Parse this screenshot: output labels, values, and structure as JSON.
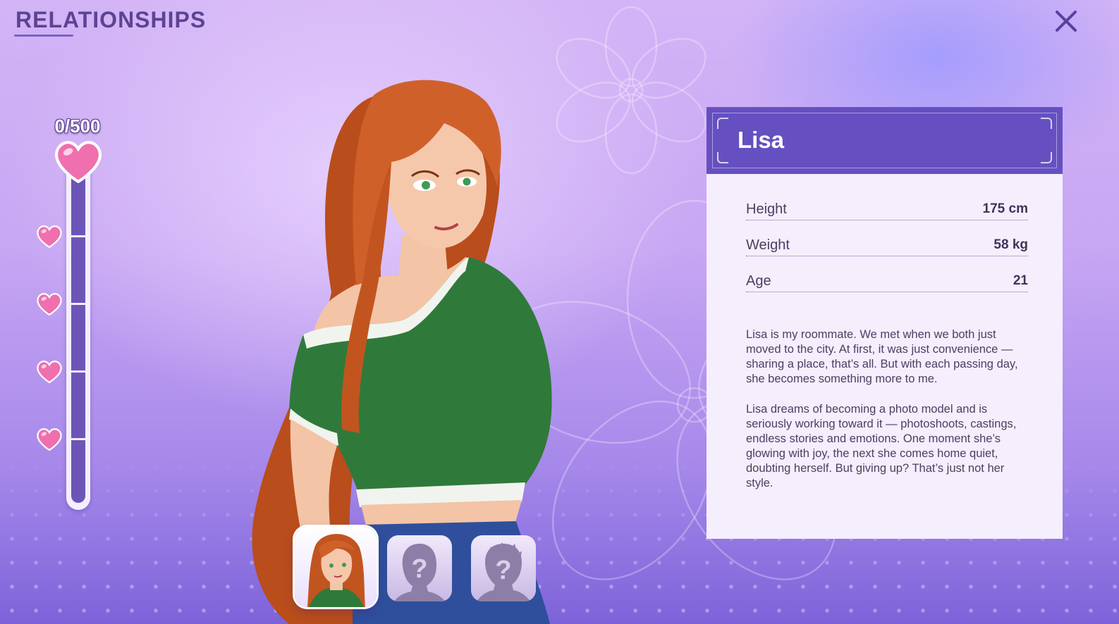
{
  "screen": {
    "title": "RELATIONSHIPS"
  },
  "meter": {
    "count_text": "0/500",
    "current": 0,
    "max": 500,
    "milestones": 4
  },
  "character": {
    "name": "Lisa",
    "stats": [
      {
        "label": "Height",
        "value": "175 cm"
      },
      {
        "label": "Weight",
        "value": "58 kg"
      },
      {
        "label": "Age",
        "value": "21"
      }
    ],
    "bio": [
      "Lisa is my roommate. We met when we both just moved to the city. At first, it was just convenience — sharing a place, that’s all. But with each passing day, she becomes something more to me.",
      "Lisa dreams of becoming a photo model and is seriously working toward it — photoshoots, castings, endless stories and emotions. One moment she’s glowing with joy, the next she comes home quiet, doubting herself. But giving up? That’s just not her style."
    ]
  },
  "tabs": [
    {
      "state": "unlocked",
      "icon": "lisa-avatar-icon"
    },
    {
      "state": "locked",
      "icon": "question-mark-icon"
    },
    {
      "state": "locked",
      "icon": "question-mark-icon"
    }
  ],
  "colors": {
    "accent": "#6650c1",
    "title": "#5c4494",
    "heart": "#f06fae",
    "card_bg": "#f5eefc"
  }
}
